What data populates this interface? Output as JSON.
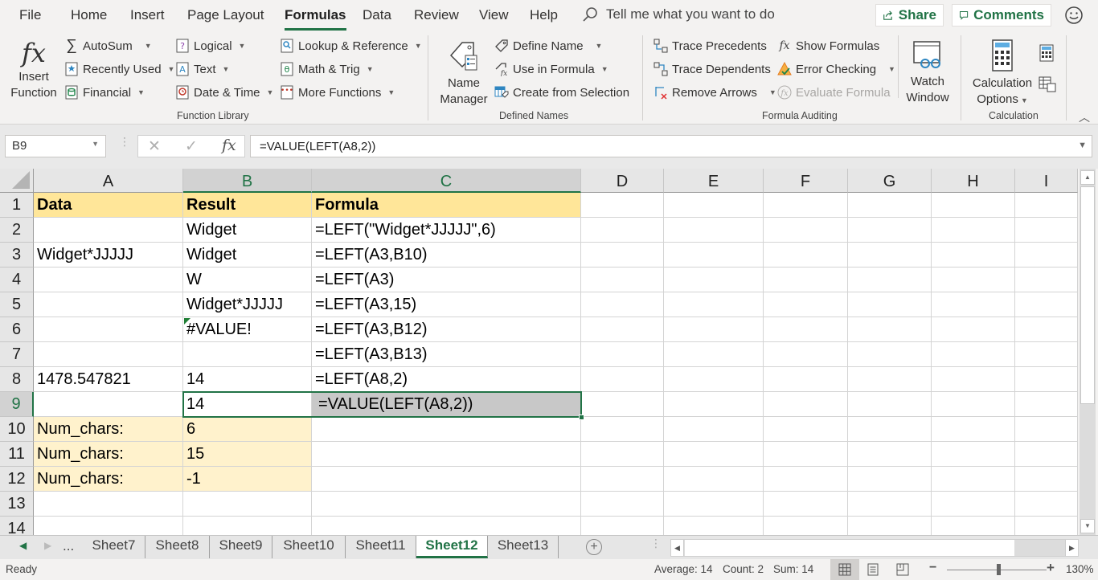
{
  "menu": {
    "tabs": [
      "File",
      "Home",
      "Insert",
      "Page Layout",
      "Formulas",
      "Data",
      "Review",
      "View",
      "Help"
    ],
    "active_tab": "Formulas",
    "tell_me": "Tell me what you want to do",
    "share": "Share",
    "comments": "Comments"
  },
  "ribbon": {
    "function_library": {
      "label": "Function Library",
      "insert_function": [
        "Insert",
        "Function"
      ],
      "items": {
        "autosum": "AutoSum",
        "recently_used": "Recently Used",
        "financial": "Financial",
        "logical": "Logical",
        "text": "Text",
        "date_time": "Date & Time",
        "lookup": "Lookup & Reference",
        "math": "Math & Trig",
        "more": "More Functions"
      }
    },
    "defined_names": {
      "label": "Defined Names",
      "name_manager": [
        "Name",
        "Manager"
      ],
      "define_name": "Define Name",
      "use_in_formula": "Use in Formula",
      "create_from_selection": "Create from Selection"
    },
    "formula_auditing": {
      "label": "Formula Auditing",
      "trace_precedents": "Trace Precedents",
      "trace_dependents": "Trace Dependents",
      "remove_arrows": "Remove Arrows",
      "show_formulas": "Show Formulas",
      "error_checking": "Error Checking",
      "evaluate_formula": "Evaluate Formula",
      "watch_window": [
        "Watch",
        "Window"
      ]
    },
    "calculation": {
      "label": "Calculation",
      "calc_options": [
        "Calculation",
        "Options"
      ]
    }
  },
  "formula_bar": {
    "name_box": "B9",
    "formula": "=VALUE(LEFT(A8,2))"
  },
  "grid": {
    "columns": [
      "A",
      "B",
      "C",
      "D",
      "E",
      "F",
      "G",
      "H",
      "I"
    ],
    "rows": [
      {
        "n": "1",
        "a": "Data",
        "b": "Result",
        "c": "Formula"
      },
      {
        "n": "2",
        "a": "",
        "b": "Widget",
        "c": "=LEFT(\"Widget*JJJJJ\",6)"
      },
      {
        "n": "3",
        "a": "Widget*JJJJJ",
        "b": "Widget",
        "c": "=LEFT(A3,B10)"
      },
      {
        "n": "4",
        "a": "",
        "b": "W",
        "c": "=LEFT(A3)"
      },
      {
        "n": "5",
        "a": "",
        "b": "Widget*JJJJJ",
        "c": "=LEFT(A3,15)"
      },
      {
        "n": "6",
        "a": "",
        "b": "#VALUE!",
        "c": "=LEFT(A3,B12)"
      },
      {
        "n": "7",
        "a": "",
        "b": "",
        "c": "=LEFT(A3,B13)"
      },
      {
        "n": "8",
        "a": "1478.547821",
        "b": "14",
        "c": "=LEFT(A8,2)"
      },
      {
        "n": "9",
        "a": "",
        "b": "14",
        "c": "=VALUE(LEFT(A8,2))"
      },
      {
        "n": "10",
        "a": "Num_chars:",
        "b": "6",
        "c": ""
      },
      {
        "n": "11",
        "a": "Num_chars:",
        "b": "15",
        "c": ""
      },
      {
        "n": "12",
        "a": "Num_chars:",
        "b": "-1",
        "c": ""
      },
      {
        "n": "13",
        "a": "",
        "b": "",
        "c": ""
      },
      {
        "n": "14",
        "a": "",
        "b": "",
        "c": ""
      }
    ],
    "selected_cell": "B9"
  },
  "sheets": {
    "ellipsis": "...",
    "tabs": [
      "Sheet7",
      "Sheet8",
      "Sheet9",
      "Sheet10",
      "Sheet11",
      "Sheet12",
      "Sheet13"
    ],
    "active": "Sheet12"
  },
  "status": {
    "ready": "Ready",
    "average": "Average: 14",
    "count": "Count: 2",
    "sum": "Sum: 14",
    "zoom": "130%"
  },
  "colors": {
    "accent": "#217346",
    "header_fill": "#ffe699",
    "light_fill": "#fff2cc"
  }
}
